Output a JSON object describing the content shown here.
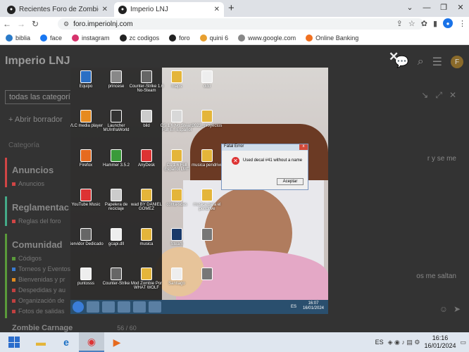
{
  "browser": {
    "tabs": [
      {
        "title": "Recientes Foro de Zombie Carna"
      },
      {
        "title": "Imperio LNJ"
      }
    ],
    "url": "foro.imperiolnj.com",
    "bookmarks": [
      "biblia",
      "face",
      "instagram",
      "zc codigos",
      "foro",
      "quini 6",
      "www.google.com",
      "Online Banking"
    ]
  },
  "forum": {
    "title": "Imperio LNJ",
    "avatar_letter": "F",
    "filter": "todas las categorías",
    "new_topic": "Abrir borrador",
    "categories_label": "Categoría",
    "sections": [
      {
        "title": "Anuncios",
        "color": "#d04545",
        "sub": [
          "Anuncios"
        ]
      },
      {
        "title": "Reglamentac",
        "color": "#44aa88",
        "sub": [
          "Reglas del foro"
        ]
      },
      {
        "title": "Comunidad",
        "color": "#5a9a3a",
        "sub": [
          "Códigos",
          "Torneos y Eventos",
          "Bienvenidas y pr",
          "Despedidas y au",
          "Organización de",
          "Fotos de salidas"
        ]
      }
    ],
    "right_text_1": "r y se me",
    "right_text_2": "os me saltan",
    "bottom_item": "Zombie Carnage",
    "bottom_value": "56 / 60"
  },
  "screenshot": {
    "icons": [
      "Equipo",
      "princese",
      "Counter-Strike 1.6 No-Steam",
      "maps",
      "ddd",
      "VLC media player",
      "Launcher MUInfraWorld",
      "bild",
      "CS 1.6 No Steam Full En Español",
      "2023_proyectos",
      "Firefox",
      "Hammer 3.5.2",
      "AnyDesk",
      "Cs 1.6 Full Español LMT",
      "musica pendrive",
      "YouTube Music",
      "Papelera de reciclaje",
      "wad BY DANIEL GOMEZ",
      "conta-sdas",
      "musica para el pendrive",
      "Servidor Dedicado",
      "gcapi.dll",
      "musica",
      "Steam",
      "",
      "puntosss",
      "Counter-Strike",
      "Mod Zombie Por WHAT WOLF",
      "Santiago",
      ""
    ],
    "dialog": {
      "title": "Fatal Error",
      "message": "Used decal #41 without a name",
      "button": "Aceptar"
    },
    "taskbar_lang": "ES",
    "clock_time": "16:07",
    "clock_date": "16/01/2024"
  },
  "taskbar": {
    "lang": "ES",
    "time": "16:16",
    "date": "16/01/2024"
  }
}
